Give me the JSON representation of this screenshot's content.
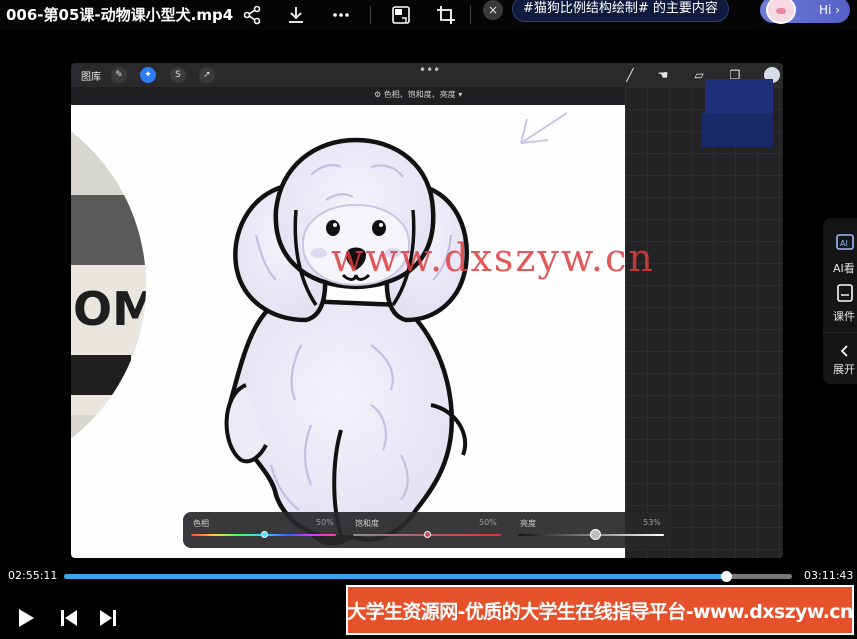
{
  "window": {
    "title": "006-第05课-动物课小型犬.mp4"
  },
  "top_bar": {
    "icons": [
      "share-icon",
      "download-icon",
      "more-icon",
      "pip-icon",
      "crop-icon"
    ],
    "close_symbol": "×",
    "topic_tag": "#猫狗比例结构绘制# 的主要内容",
    "hi_button": "Hi ›"
  },
  "procreate": {
    "gallery_label": "图库",
    "tools": [
      "wrench-icon",
      "magic-wand-icon",
      "selection-icon",
      "move-icon"
    ],
    "right_tools": [
      "brush-icon",
      "smudge-icon",
      "eraser-icon",
      "layers-icon",
      "color-icon"
    ],
    "sub_label": "色相、饱和度、亮度",
    "hsb": {
      "hue": {
        "label": "色相",
        "value_text": "50%",
        "value": 0.5
      },
      "saturation": {
        "label": "饱和度",
        "value_text": "50%",
        "value": 0.5
      },
      "brightness": {
        "label": "亮度",
        "value_text": "53%",
        "value": 0.53
      }
    }
  },
  "video_watermark": "www.dxszyw.cn",
  "side_panel": {
    "items": [
      {
        "label": "AI看",
        "icon": "ai-icon"
      },
      {
        "label": "课件",
        "icon": "courseware-icon"
      },
      {
        "label": "展开",
        "icon": "chevron-left-icon"
      }
    ]
  },
  "player": {
    "current_time": "02:55:11",
    "total_time": "03:11:43",
    "progress": 0.91,
    "controls": [
      "play-icon",
      "previous-icon",
      "next-icon"
    ]
  },
  "banner": {
    "text": "大学生资源网-优质的大学生在线指导平台-www.dxszyw.cn"
  },
  "colors": {
    "progress": "#3aa4ee",
    "banner_bg": "#e4512a",
    "procreate_active": "#2f7cf6"
  }
}
